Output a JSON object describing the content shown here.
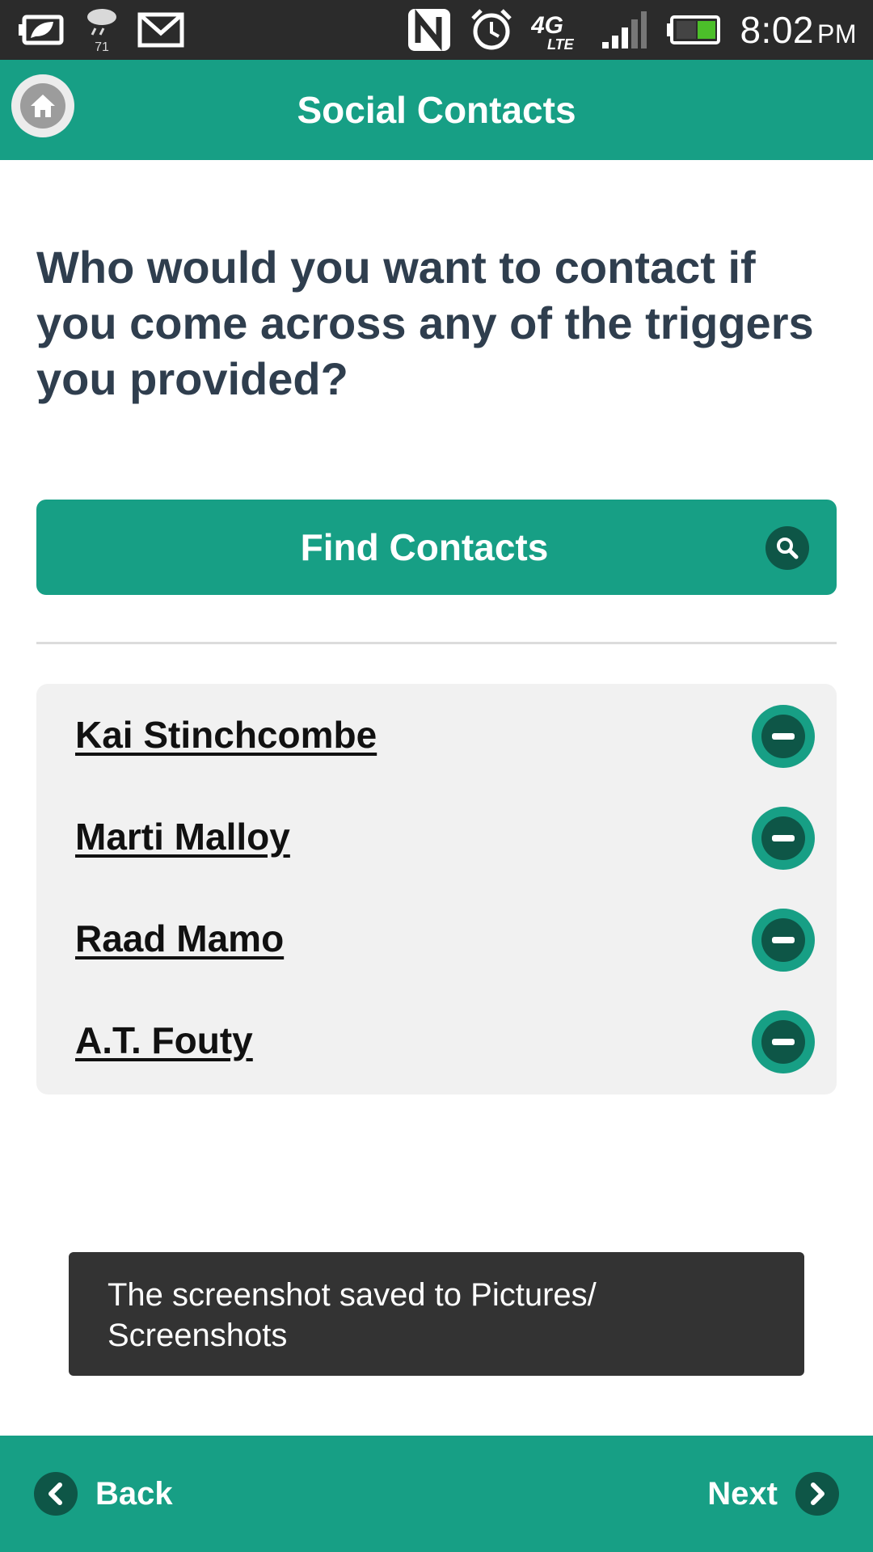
{
  "status_bar": {
    "weather_temp": "71",
    "time": "8:02",
    "ampm": "PM",
    "network": "4G LTE",
    "icons": [
      "leaf-battery-saver-icon",
      "weather-icon",
      "gmail-icon",
      "nfc-icon",
      "alarm-icon",
      "lte-icon",
      "signal-icon",
      "battery-icon"
    ]
  },
  "header": {
    "title": "Social Contacts",
    "home_icon": "home-icon"
  },
  "main": {
    "question": "Who would you want to contact if you come across any of the triggers you provided?",
    "find_button_label": "Find Contacts",
    "contacts": [
      {
        "name": "Kai Stinchcombe"
      },
      {
        "name": "Marti Malloy"
      },
      {
        "name": "Raad Mamo"
      },
      {
        "name": "A.T. Fouty"
      }
    ]
  },
  "toast": {
    "message": "The screenshot saved to Pictures/ Screenshots"
  },
  "footer": {
    "back_label": "Back",
    "next_label": "Next"
  },
  "colors": {
    "accent": "#179f85",
    "accent_dark": "#0e5647",
    "question_text": "#2f3e4e",
    "status_bar": "#2b2b2b",
    "toast_bg": "#333333"
  }
}
